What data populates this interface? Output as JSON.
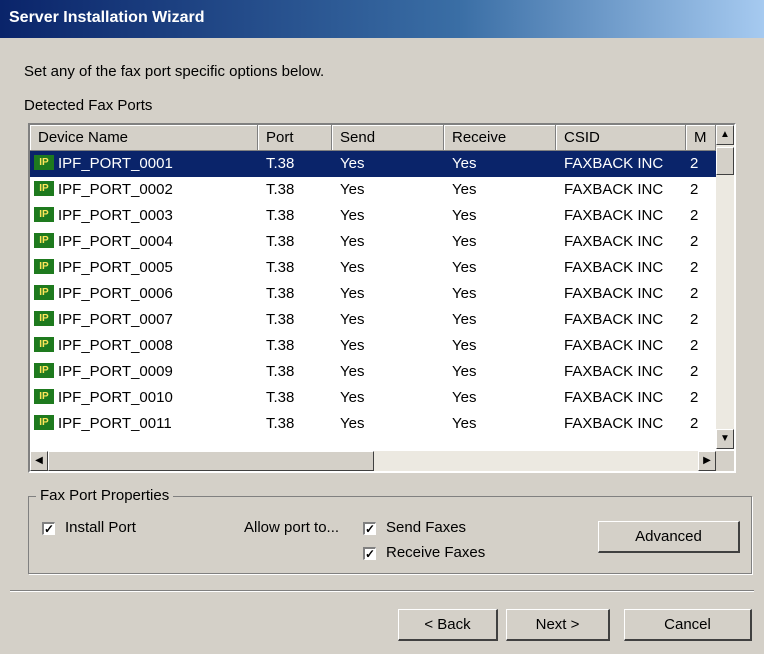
{
  "window": {
    "title": "Server Installation Wizard"
  },
  "instructions": "Set any of the fax port specific options below.",
  "ports_label": "Detected Fax Ports",
  "columns": [
    "Device Name",
    "Port",
    "Send",
    "Receive",
    "CSID",
    "M"
  ],
  "rows": [
    {
      "device": "IPF_PORT_0001",
      "port": "T.38",
      "send": "Yes",
      "receive": "Yes",
      "csid": "FAXBACK INC",
      "m": "2",
      "selected": true
    },
    {
      "device": "IPF_PORT_0002",
      "port": "T.38",
      "send": "Yes",
      "receive": "Yes",
      "csid": "FAXBACK INC",
      "m": "2"
    },
    {
      "device": "IPF_PORT_0003",
      "port": "T.38",
      "send": "Yes",
      "receive": "Yes",
      "csid": "FAXBACK INC",
      "m": "2"
    },
    {
      "device": "IPF_PORT_0004",
      "port": "T.38",
      "send": "Yes",
      "receive": "Yes",
      "csid": "FAXBACK INC",
      "m": "2"
    },
    {
      "device": "IPF_PORT_0005",
      "port": "T.38",
      "send": "Yes",
      "receive": "Yes",
      "csid": "FAXBACK INC",
      "m": "2"
    },
    {
      "device": "IPF_PORT_0006",
      "port": "T.38",
      "send": "Yes",
      "receive": "Yes",
      "csid": "FAXBACK INC",
      "m": "2"
    },
    {
      "device": "IPF_PORT_0007",
      "port": "T.38",
      "send": "Yes",
      "receive": "Yes",
      "csid": "FAXBACK INC",
      "m": "2"
    },
    {
      "device": "IPF_PORT_0008",
      "port": "T.38",
      "send": "Yes",
      "receive": "Yes",
      "csid": "FAXBACK INC",
      "m": "2"
    },
    {
      "device": "IPF_PORT_0009",
      "port": "T.38",
      "send": "Yes",
      "receive": "Yes",
      "csid": "FAXBACK INC",
      "m": "2"
    },
    {
      "device": "IPF_PORT_0010",
      "port": "T.38",
      "send": "Yes",
      "receive": "Yes",
      "csid": "FAXBACK INC",
      "m": "2"
    },
    {
      "device": "IPF_PORT_0011",
      "port": "T.38",
      "send": "Yes",
      "receive": "Yes",
      "csid": "FAXBACK INC",
      "m": "2"
    }
  ],
  "icon": {
    "name": "ip-port-icon",
    "glyph": "IP"
  },
  "properties": {
    "title": "Fax Port Properties",
    "install_port": "Install Port",
    "allow_label": "Allow port to...",
    "send_faxes": "Send Faxes",
    "receive_faxes": "Receive Faxes",
    "advanced": "Advanced"
  },
  "buttons": {
    "back": "< Back",
    "next": "Next >",
    "cancel": "Cancel"
  },
  "colors": {
    "selection": "#0a246a",
    "face": "#d4d0c8"
  }
}
